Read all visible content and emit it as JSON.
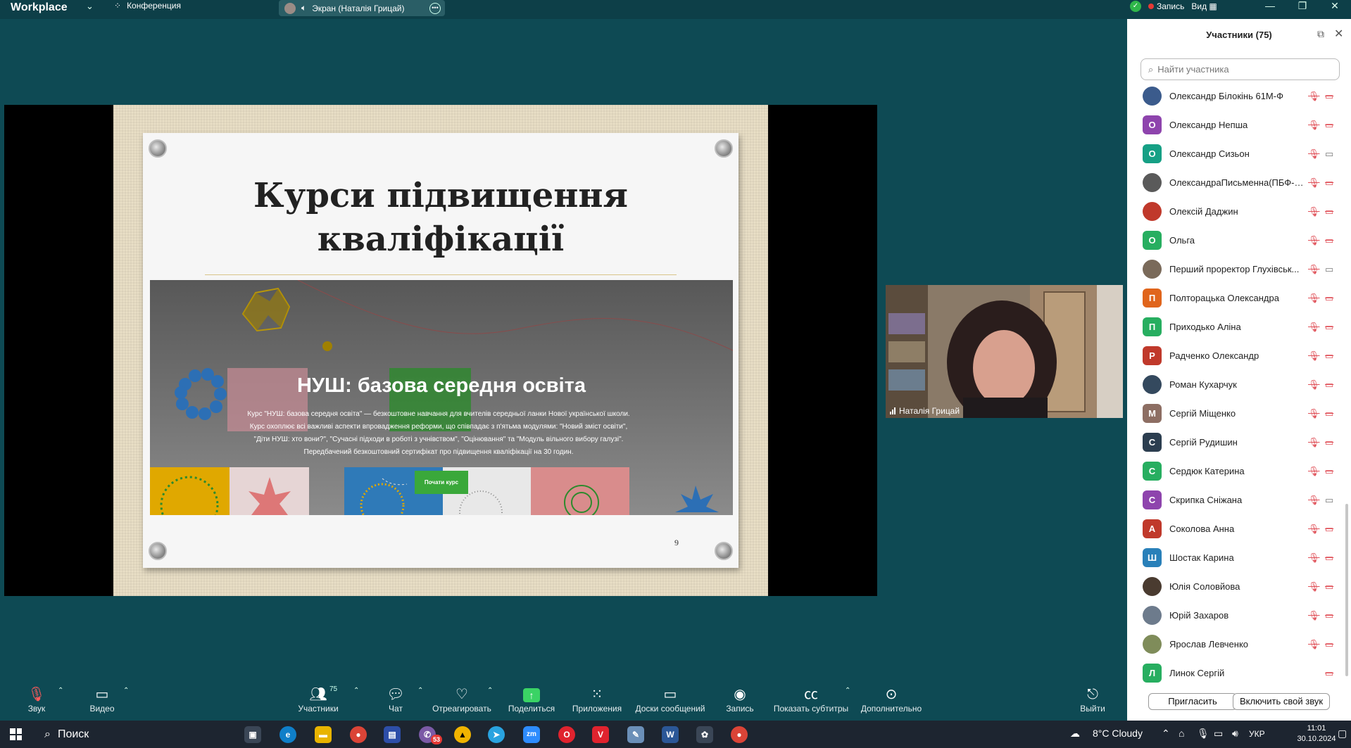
{
  "topbar": {
    "brand": "Workplace",
    "brand_icon": "chevron-down-icon",
    "conference_label": "Конференция",
    "screen_label": "Экран (Наталія Грицай)",
    "recording_label": "Запись",
    "view_label": "Вид",
    "status_colors": {
      "shield": "#2fb64a",
      "record": "#e53935"
    }
  },
  "slide": {
    "title_line1": "Курси підвищення",
    "title_line2": "кваліфікації",
    "page_number": "9",
    "banner_title": "НУШ: базова середня освіта",
    "banner_desc_1": "Курс \"НУШ: базова середня освіта\" — безкоштовне навчання для вчителів середньої ланки Нової української школи.",
    "banner_desc_2": "Курс охоплює всі важливі аспекти впровадження реформи, що співпадає з п'ятьма модулями: \"Новий зміст освіти\",",
    "banner_desc_3": "\"Діти НУШ: хто вони?\", \"Сучасні підходи в роботі з учнівством\", \"Оцінювання\" та \"Модуль вільного вибору галузі\".",
    "banner_desc_4": "Передбачений безкоштовний сертифікат про підвищення кваліфікації на 30 годин.",
    "banner_button": "Почати курс"
  },
  "webcam": {
    "name": "Наталія Грицай"
  },
  "participants": {
    "header": "Участники (75)",
    "search_placeholder": "Найти участника",
    "items": [
      {
        "name": "Олександр Білокінь 61М-Ф",
        "initial": "",
        "color": "#3b5b8c",
        "photo": true,
        "cam_on": false
      },
      {
        "name": "Олександр Непша",
        "initial": "О",
        "color": "#8e44ad",
        "photo": false,
        "cam_on": false
      },
      {
        "name": "Олександр Сизьон",
        "initial": "О",
        "color": "#16a085",
        "photo": false,
        "cam_on": true
      },
      {
        "name": "ОлександраПисьменна(ПБФ-5...",
        "initial": "",
        "color": "#5a5a5a",
        "photo": true,
        "cam_on": false
      },
      {
        "name": "Олексій Даджин",
        "initial": "",
        "color": "#c0392b",
        "photo": true,
        "cam_on": false
      },
      {
        "name": "Ольга",
        "initial": "О",
        "color": "#27ae60",
        "photo": false,
        "cam_on": false
      },
      {
        "name": "Перший проректор Глухівськ...",
        "initial": "",
        "color": "#7a6a5a",
        "photo": true,
        "cam_on": true
      },
      {
        "name": "Полторацька Олександра",
        "initial": "П",
        "color": "#e0651c",
        "photo": false,
        "cam_on": false
      },
      {
        "name": "Приходько Аліна",
        "initial": "П",
        "color": "#27ae60",
        "photo": false,
        "cam_on": false
      },
      {
        "name": "Радченко Олександр",
        "initial": "Р",
        "color": "#c0392b",
        "photo": false,
        "cam_on": false
      },
      {
        "name": "Роман Кухарчук",
        "initial": "",
        "color": "#34495e",
        "photo": true,
        "cam_on": false
      },
      {
        "name": "Сергій Міщенко",
        "initial": "М",
        "color": "#8d6e63",
        "photo": false,
        "cam_on": false
      },
      {
        "name": "Сергій Рудишин",
        "initial": "С",
        "color": "#2c3e50",
        "photo": false,
        "cam_on": false
      },
      {
        "name": "Сердюк Катерина",
        "initial": "С",
        "color": "#27ae60",
        "photo": false,
        "cam_on": false
      },
      {
        "name": "Скрипка Сніжана",
        "initial": "С",
        "color": "#8e44ad",
        "photo": false,
        "cam_on": true
      },
      {
        "name": "Соколова Анна",
        "initial": "А",
        "color": "#c0392b",
        "photo": false,
        "cam_on": false
      },
      {
        "name": "Шостак  Карина",
        "initial": "Ш",
        "color": "#2980b9",
        "photo": false,
        "cam_on": false
      },
      {
        "name": "Юлія Соловйова",
        "initial": "",
        "color": "#4a3b30",
        "photo": true,
        "cam_on": false
      },
      {
        "name": "Юрій Захаров",
        "initial": "",
        "color": "#6d7b8c",
        "photo": true,
        "cam_on": false
      },
      {
        "name": "Ярослав Левченко",
        "initial": "",
        "color": "#7f8c5a",
        "photo": true,
        "cam_on": false
      },
      {
        "name": "Линок Сергій",
        "initial": "Л",
        "color": "#27ae60",
        "photo": false,
        "cam_on": false,
        "no_mic": true
      }
    ],
    "invite_button": "Пригласить",
    "unmute_button": "Включить свой звук"
  },
  "toolbar": {
    "audio": "Звук",
    "video": "Видео",
    "participants": "Участники",
    "participants_count": "75",
    "chat": "Чат",
    "react": "Отреагировать",
    "share": "Поделиться",
    "apps": "Приложения",
    "boards": "Доски сообщений",
    "record": "Запись",
    "captions": "Показать субтитры",
    "more": "Дополнительно",
    "leave": "Выйти"
  },
  "taskbar": {
    "search": "Поиск",
    "weather": "8°C  Cloudy",
    "lang": "УКР",
    "time": "11:01",
    "date": "30.10.2024",
    "badge_count": "53"
  }
}
